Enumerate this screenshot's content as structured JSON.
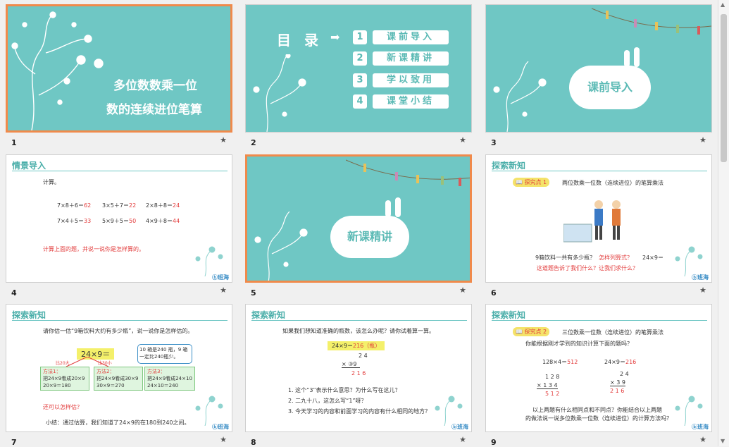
{
  "slides": [
    {
      "num": "1",
      "title_line1": "多位数数乘一位",
      "title_line2": "数的连续进位笔算"
    },
    {
      "num": "2",
      "menu_label": "目 录",
      "items": [
        {
          "n": "1",
          "label": "课前导入"
        },
        {
          "n": "2",
          "label": "新课精讲"
        },
        {
          "n": "3",
          "label": "学以致用"
        },
        {
          "n": "4",
          "label": "课堂小结"
        }
      ]
    },
    {
      "num": "3",
      "cloud": "课前导入"
    },
    {
      "num": "4",
      "header": "情景导入",
      "intro": "计算。",
      "eqs": [
        [
          "7×8＋6＝",
          "62"
        ],
        [
          "3×5＋7＝",
          "22"
        ],
        [
          "2×8＋8＝",
          "24"
        ],
        [
          "7×4＋5＝",
          "33"
        ],
        [
          "5×9＋5＝",
          "50"
        ],
        [
          "4×9＋8＝",
          "44"
        ]
      ],
      "note": "计算上面的题，并说一说你是怎样算的。"
    },
    {
      "num": "5",
      "cloud": "新课精讲"
    },
    {
      "num": "6",
      "header": "探索新知",
      "tag": "探究点 1",
      "tag_text": "两位数乘一位数（连续进位）的笔算乘法",
      "q1": "9箱饮料一共有多少瓶？",
      "q1b": "怎样列算式？",
      "q1c": "24×9＝",
      "q2": "这道题告诉了我们什么？让我们求什么？"
    },
    {
      "num": "7",
      "header": "探索新知",
      "q": "请你估一估“9箱饮料大约有多少瓶”，说一说你是怎样估的。",
      "expr": "24×9＝",
      "l1": "比20大",
      "l2": "比30小",
      "bubble": "10 箱是240 瓶，9 箱一定比240瓶少。",
      "m1": [
        "方法1：",
        "把24×9看成20×9",
        "20×9＝180"
      ],
      "m2": [
        "方法2：",
        "把24×9看成30×9",
        "30×9＝270"
      ],
      "m3": [
        "方法3：",
        "把24×9看成24×10",
        "24×10＝240"
      ],
      "ask": "还可以怎样估？",
      "summary": "小结：通过估算，我们知道了24×9的在180到240之间。"
    },
    {
      "num": "8",
      "header": "探索新知",
      "q": "如果我们想知道准确的瓶数，该怎么办呢？请你试着算一算。",
      "eq": "24×9＝",
      "eq_ans": "216（瓶）",
      "v1": "2 4",
      "v2": "×  ③9",
      "v3": "2 1 6",
      "p1": "1. 这个“3”表示什么意思？为什么写在这儿？",
      "p2": "2. 二九十八，这怎么写“1”呀？",
      "p3": "3. 今天学习的内容和前面学习的内容有什么相同的地方？"
    },
    {
      "num": "9",
      "header": "探索新知",
      "tag": "探究点 2",
      "tag_text": "三位数乘一位数（连续进位）的笔算乘法",
      "q": "你能根据刚才学到的知识计算下面的题吗？",
      "e1": "128×4＝",
      "e1a": "512",
      "e2": "24×9＝",
      "e2a": "216",
      "c1": [
        "1  2  8",
        "×  1  3  4",
        "5  1  2"
      ],
      "c2": [
        "2  4",
        "×  3  9",
        "2  1  6"
      ],
      "end1": "以上两题有什么相同点和不同点？你能结合以上两题",
      "end2": "的做法说一说多位数乘一位数（连续进位）的计算方法吗？"
    }
  ],
  "logo": "班海",
  "star": "★",
  "colors": {
    "teal": "#6fc7c4",
    "accent": "#f08a4b",
    "red": "#e23b3b"
  }
}
